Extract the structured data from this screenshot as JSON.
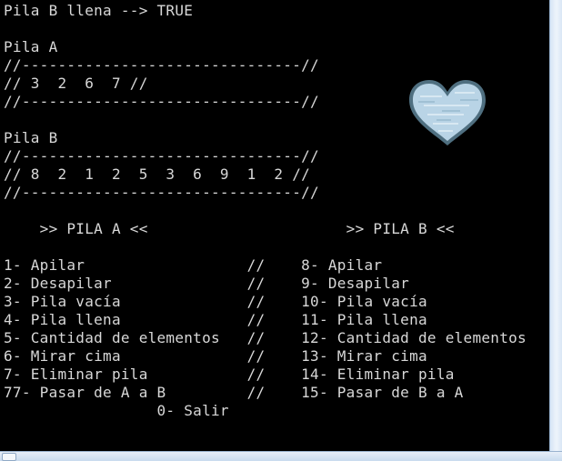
{
  "console": {
    "lines": [
      "Pila B llena --> TRUE",
      "",
      "Pila A",
      "//-------------------------------//",
      "// 3  2  6  7 //",
      "//-------------------------------//",
      "",
      "Pila B",
      "//-------------------------------//",
      "// 8  2  1  2  5  3  6  9  1  2 //",
      "//-------------------------------//",
      "",
      "    >> PILA A <<                      >> PILA B <<",
      "",
      "1- Apilar                  //    8- Apilar",
      "2- Desapilar               //    9- Desapilar",
      "3- Pila vacía              //    10- Pila vacía",
      "4- Pila llena              //    11- Pila llena",
      "5- Cantidad de elementos   //    12- Cantidad de elementos",
      "6- Mirar cima              //    13- Mirar cima",
      "7- Eliminar pila           //    14- Eliminar pila",
      "77- Pasar de A a B         //    15- Pasar de B a A",
      "                 0- Salir"
    ]
  },
  "decoration": {
    "icon": "heart-icon",
    "colors": {
      "background": "#000000",
      "text": "#d8d8d8",
      "heart_fill": "#b9d4e6",
      "heart_outline": "#4f6f80"
    }
  }
}
